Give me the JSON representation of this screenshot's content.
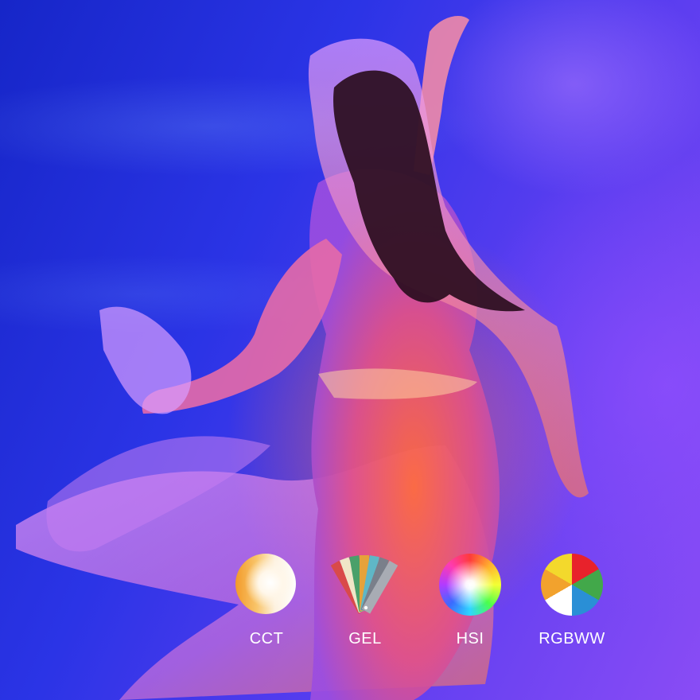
{
  "photo": {
    "subject": "dancer-with-flowing-fabric",
    "colors": {
      "background_blue": "#2b34e6",
      "background_violet": "#8a4cf5",
      "warm_light": "#ff6a3a",
      "fabric_pink": "#e37ad8"
    }
  },
  "light_modes": [
    {
      "label": "CCT",
      "icon": "cct-gradient-circle-icon"
    },
    {
      "label": "GEL",
      "icon": "gel-swatch-fan-icon"
    },
    {
      "label": "HSI",
      "icon": "hsi-color-wheel-icon"
    },
    {
      "label": "RGBWW",
      "icon": "rgbww-pie-icon"
    }
  ]
}
